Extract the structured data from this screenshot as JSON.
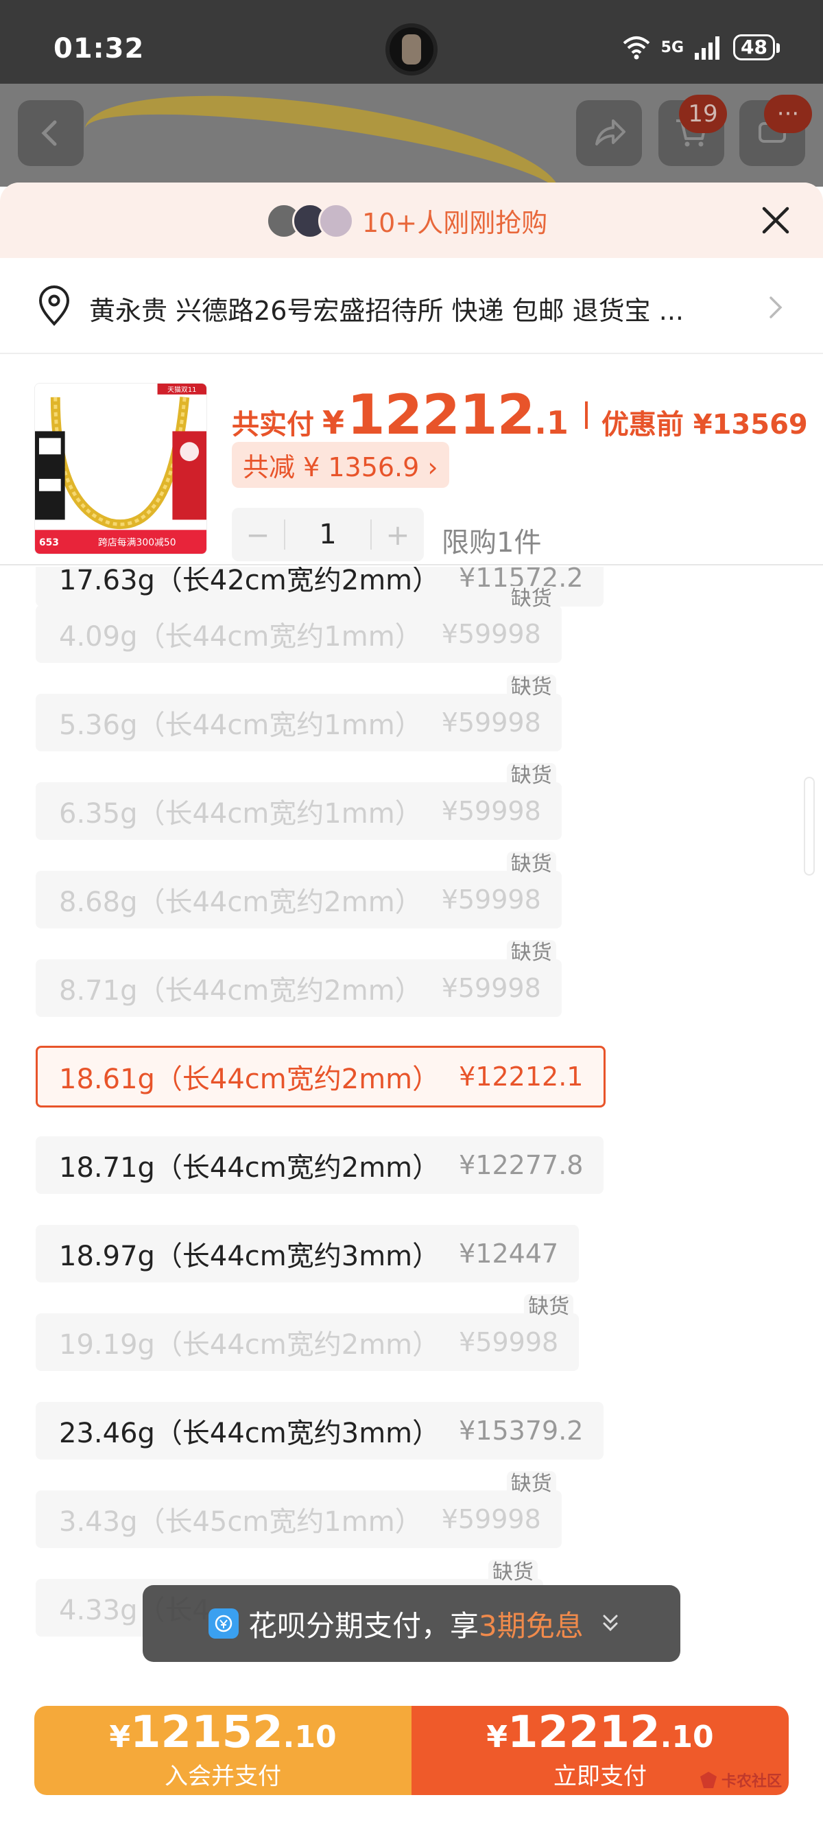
{
  "status_bar": {
    "time": "01:32",
    "network": "5G",
    "battery": "48"
  },
  "header": {
    "cart_badge": "19",
    "more_badge": "···"
  },
  "sheet": {
    "snap_text": "10+人刚刚抢购",
    "address": "黄永贵 兴德路26号宏盛招待所  快递 包邮 退货宝 ...",
    "product": {
      "pay_label": "共实付",
      "pay_yen": "¥",
      "pay_int": "12212",
      "pay_dec": ".1",
      "before_label": "优惠前 ¥13569",
      "saving": "共减 ¥ 1356.9 ›",
      "quantity": "1",
      "minus": "−",
      "plus": "+",
      "limit": "限购1件",
      "image_texts": {
        "badge": "天猫双11",
        "promo": "跨店每满300减50",
        "count": "653"
      }
    },
    "options": [
      {
        "label": "17.63g（长42cm宽约2mm）",
        "price": "¥11572.2",
        "state": "normal",
        "oos": ""
      },
      {
        "label": "4.09g（长44cm宽约1mm）",
        "price": "¥59998",
        "state": "disabled",
        "oos": "缺货"
      },
      {
        "label": "5.36g（长44cm宽约1mm）",
        "price": "¥59998",
        "state": "disabled",
        "oos": "缺货"
      },
      {
        "label": "6.35g（长44cm宽约1mm）",
        "price": "¥59998",
        "state": "disabled",
        "oos": "缺货"
      },
      {
        "label": "8.68g（长44cm宽约2mm）",
        "price": "¥59998",
        "state": "disabled",
        "oos": "缺货"
      },
      {
        "label": "8.71g（长44cm宽约2mm）",
        "price": "¥59998",
        "state": "disabled",
        "oos": "缺货"
      },
      {
        "label": "18.61g（长44cm宽约2mm）",
        "price": "¥12212.1",
        "state": "selected",
        "oos": ""
      },
      {
        "label": "18.71g（长44cm宽约2mm）",
        "price": "¥12277.8",
        "state": "normal",
        "oos": ""
      },
      {
        "label": "18.97g（长44cm宽约3mm）",
        "price": "¥12447",
        "state": "normal",
        "oos": ""
      },
      {
        "label": "19.19g（长44cm宽约2mm）",
        "price": "¥59998",
        "state": "disabled",
        "oos": "缺货"
      },
      {
        "label": "23.46g（长44cm宽约3mm）",
        "price": "¥15379.2",
        "state": "normal",
        "oos": ""
      },
      {
        "label": "3.43g（长45cm宽约1mm）",
        "price": "¥59998",
        "state": "disabled",
        "oos": "缺货"
      },
      {
        "label": "4.33g（长4",
        "price": "",
        "state": "disabled",
        "oos": "缺货"
      }
    ]
  },
  "toast": {
    "text": "花呗分期支付，享",
    "highlight": "3期免息"
  },
  "bottom": {
    "member": {
      "yen": "¥",
      "int": "12152",
      "dec": ".10",
      "label": "入会并支付"
    },
    "pay": {
      "yen": "¥",
      "int": "12212",
      "dec": ".10",
      "label": "立即支付"
    },
    "watermark": "卡农社区"
  },
  "colors": {
    "accent": "#e8542a",
    "member": "#f5a93a",
    "pay": "#ef5a2a"
  }
}
